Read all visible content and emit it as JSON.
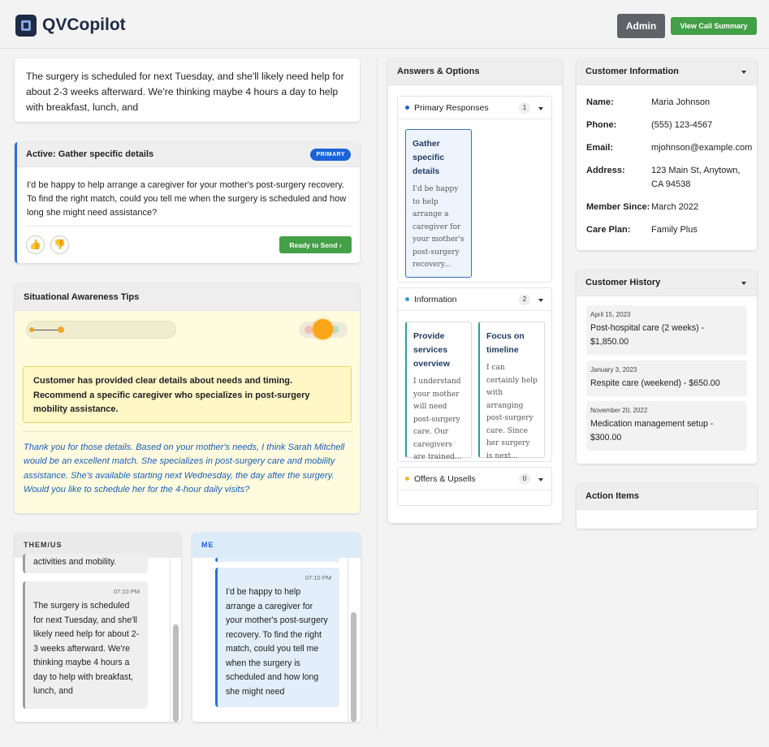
{
  "app": {
    "title": "QVCopilot"
  },
  "header": {
    "admin_label": "Admin",
    "summary_label": "View Call Summary"
  },
  "transcript": {
    "text": "The surgery is scheduled for next Tuesday, and she'll likely need help for about 2-3 weeks afterward. We're thinking maybe 4 hours a day to help with breakfast, lunch, and"
  },
  "active": {
    "title": "Active: Gather specific details",
    "badge": "PRIMARY",
    "text": "I'd be happy to help arrange a caregiver for your mother's post-surgery recovery. To find the right match, could you tell me when the surgery is scheduled and how long she might need assistance?",
    "ready_label": "Ready to Send ›"
  },
  "tips": {
    "title": "Situational Awareness Tips",
    "alert": "Customer has provided clear details about needs and timing. Recommend a specific caregiver who specializes in post-surgery mobility assistance.",
    "script": "Thank you for those details. Based on your mother's needs, I think Sarah Mitchell would be an excellent match. She specializes in post-surgery care and mobility assistance. She's available starting next Wednesday, the day after the surgery. Would you like to schedule her for the 4-hour daily visits?"
  },
  "chat": {
    "them_header": "THEM/US",
    "me_header": "ME",
    "them_partial": "activities and mobility.",
    "them_msg": {
      "time": "07:10 PM",
      "text": "The surgery is scheduled for next Tuesday, and she'll likely need help for about 2-3 weeks afterward. We're thinking maybe 4 hours a day to help with breakfast, lunch, and"
    },
    "me_msg": {
      "time": "07:10 PM",
      "text": "I'd be happy to help arrange a caregiver for your mother's post-surgery recovery. To find the right match, could you tell me when the surgery is scheduled and how long she might need"
    }
  },
  "answers": {
    "title": "Answers & Options",
    "primary": {
      "label": "Primary Responses",
      "count": "1",
      "color": "#1a63d8",
      "options": [
        {
          "title": "Gather specific details",
          "desc": "I'd be happy to help arrange a caregiver for your mother's post-surgery recovery..."
        }
      ]
    },
    "information": {
      "label": "Information",
      "count": "2",
      "color": "#2a9fc6",
      "options": [
        {
          "title": "Provide services overview",
          "desc": "I understand your mother will need post-surgery care. Our caregivers are trained..."
        },
        {
          "title": "Focus on timeline",
          "desc": "I can certainly help with arranging post-surgery care. Since her surgery is next..."
        }
      ]
    },
    "offers": {
      "label": "Offers & Upsells",
      "count": "0",
      "color": "#f0b429"
    }
  },
  "customer": {
    "title": "Customer Information",
    "name_k": "Name:",
    "name_v": "Maria Johnson",
    "phone_k": "Phone:",
    "phone_v": "(555) 123-4567",
    "email_k": "Email:",
    "email_v": "mjohnson@example.com",
    "address_k": "Address:",
    "address_v": "123 Main St, Anytown, CA 94538",
    "member_k": "Member Since:",
    "member_v": "March 2022",
    "plan_k": "Care Plan:",
    "plan_v": "Family Plus"
  },
  "history": {
    "title": "Customer History",
    "items": [
      {
        "date": "April 15, 2023",
        "desc": "Post-hospital care (2 weeks) - $1,850.00"
      },
      {
        "date": "January 3, 2023",
        "desc": "Respite care (weekend) - $650.00"
      },
      {
        "date": "November 20, 2022",
        "desc": "Medication management setup - $300.00"
      }
    ]
  },
  "action_items": {
    "title": "Action Items"
  }
}
